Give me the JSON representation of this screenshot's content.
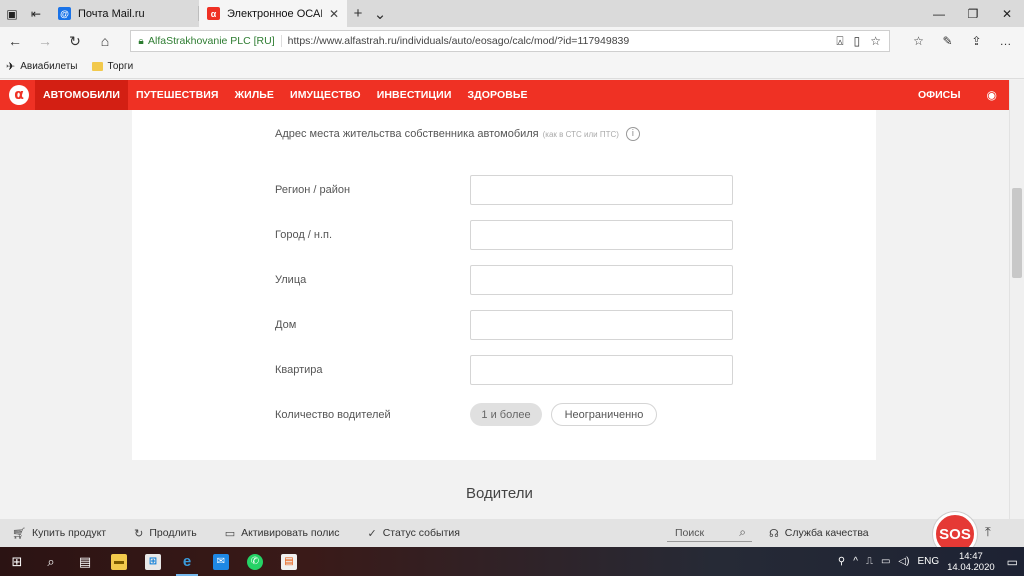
{
  "browser": {
    "tabs": [
      {
        "title": "Почта Mail.ru",
        "favicon": "mail-icon",
        "active": false
      },
      {
        "title": "Электронное ОСАГО",
        "favicon": "alfa-icon",
        "active": true
      }
    ],
    "cert_label": "AlfaStrakhovanie PLC [RU]",
    "url": "https://www.alfastrah.ru/individuals/auto/eosago/calc/mod/?id=117949839",
    "bookmarks": [
      {
        "label": "Авиабилеты",
        "icon": "plane-icon"
      },
      {
        "label": "Торги",
        "icon": "folder-icon"
      }
    ]
  },
  "site": {
    "logo_glyph": "α",
    "brand_color": "#ef3124",
    "nav": [
      {
        "label": "АВТОМОБИЛИ",
        "active": true
      },
      {
        "label": "ПУТЕШЕСТВИЯ",
        "active": false
      },
      {
        "label": "ЖИЛЬЕ",
        "active": false
      },
      {
        "label": "ИМУЩЕСТВО",
        "active": false
      },
      {
        "label": "ИНВЕСТИЦИИ",
        "active": false
      },
      {
        "label": "ЗДОРОВЬЕ",
        "active": false
      }
    ],
    "offices_label": "ОФИСЫ"
  },
  "form": {
    "section_title": "Адрес места жительства собственника автомобиля",
    "section_hint": "(как в СТС или ПТС)",
    "fields": [
      {
        "label": "Регион / район",
        "value": ""
      },
      {
        "label": "Город / н.п.",
        "value": ""
      },
      {
        "label": "Улица",
        "value": ""
      },
      {
        "label": "Дом",
        "value": ""
      },
      {
        "label": "Квартира",
        "value": ""
      }
    ],
    "drivers_count": {
      "label": "Количество водителей",
      "options": [
        {
          "label": "1 и более",
          "selected": true
        },
        {
          "label": "Неограниченно",
          "selected": false
        }
      ]
    }
  },
  "drivers_section_title": "Водители",
  "bottom_bar": {
    "items": [
      {
        "label": "Купить продукт",
        "icon": "cart-icon"
      },
      {
        "label": "Продлить",
        "icon": "renew-icon"
      },
      {
        "label": "Активировать полис",
        "icon": "card-icon"
      },
      {
        "label": "Статус события",
        "icon": "check-circle-icon"
      }
    ],
    "search_placeholder": "Поиск",
    "quality_label": "Служба качества",
    "sos_label": "SOS"
  },
  "taskbar": {
    "lang": "ENG",
    "time": "14:47",
    "date": "14.04.2020"
  }
}
